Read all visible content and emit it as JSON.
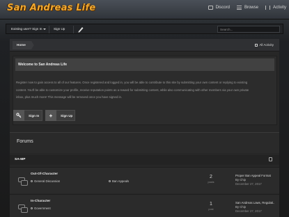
{
  "site": {
    "logo_text": "San Andreas Life"
  },
  "topnav": [
    {
      "label": "Discord",
      "icon": "discord-icon"
    },
    {
      "label": "Browse",
      "icon": "browse-icon"
    },
    {
      "label": "Activity",
      "icon": "activity-icon"
    }
  ],
  "userbar": {
    "signin_label": "Existing user? Sign In",
    "signup_label": "Sign Up",
    "search_placeholder": "Search..."
  },
  "breadcrumb": {
    "home": "Home",
    "all_activity": "All Activity"
  },
  "welcome": {
    "title": "Welcome to San Andreas Life",
    "text_line1": "Register now to gain access to all of our features. Once registered and logged in, you will be able to contribute to this site by submitting your own content or replying to existing",
    "text_line2": "content. You'll be able to customize your profile, receive reputation points as a reward for submitting content, while also communicating with other members via your own private",
    "text_line3": "inbox, plus much more! This message will be removed once you have signed in.",
    "signin_button": "Sign In",
    "signup_button": "Sign Up"
  },
  "forums": {
    "title": "Forums",
    "category": "SA-MP",
    "rows": [
      {
        "title": "Out-Of-Character",
        "sub1": "General Discussion",
        "sub2": "Ban Appeals",
        "count": "2",
        "count_label": "posts",
        "last_title": "Proper Ban Appeal Format",
        "last_by": "By Chip",
        "last_date": "December 27, 2017"
      },
      {
        "title": "In-Character",
        "sub1": "Government",
        "sub2": "",
        "count": "1",
        "count_label": "post",
        "last_title": "San Andreas Laws, Regulati..",
        "last_by": "By Chip",
        "last_date": "December 27, 2017"
      }
    ]
  },
  "colors": {
    "logo": "#f0a830",
    "background": "#1c1c1c",
    "panel": "#272727"
  }
}
